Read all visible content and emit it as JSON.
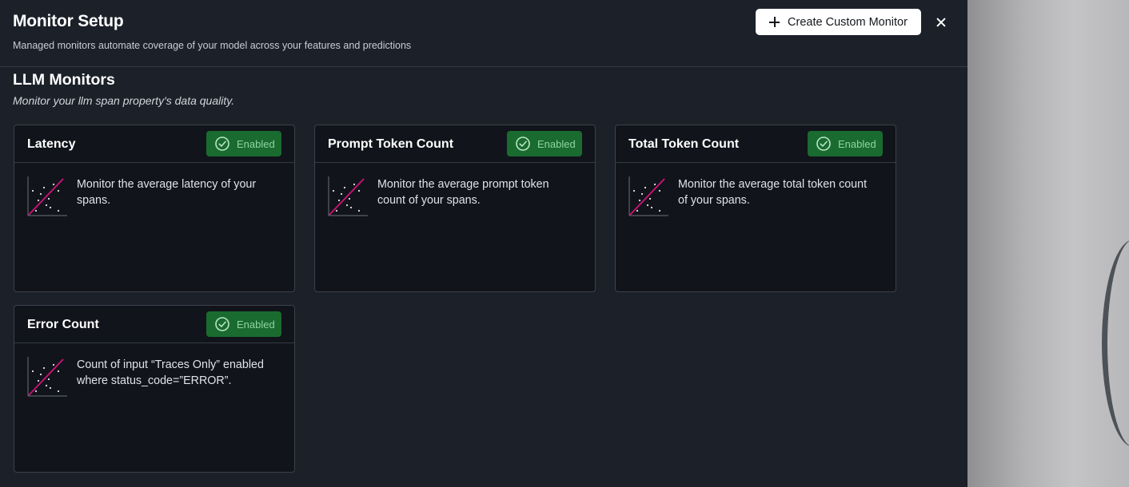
{
  "header": {
    "title": "Monitor Setup",
    "subtitle": "Managed monitors automate coverage of your model across your features and predictions",
    "create_button_label": "Create Custom Monitor"
  },
  "section": {
    "title": "LLM Monitors",
    "subtitle": "Monitor your llm span property's data quality."
  },
  "cards": [
    {
      "title": "Latency",
      "status": "Enabled",
      "description": "Monitor the average latency of your spans."
    },
    {
      "title": "Prompt Token Count",
      "status": "Enabled",
      "description": "Monitor the average prompt token count of your spans."
    },
    {
      "title": "Total Token Count",
      "status": "Enabled",
      "description": "Monitor the average total token count of your spans."
    },
    {
      "title": "Error Count",
      "status": "Enabled",
      "description": "Count of input “Traces Only” enabled where status_code=”ERROR”."
    }
  ],
  "colors": {
    "panel_bg": "#1b2029",
    "card_bg": "#11141a",
    "badge_bg": "#1a6b30",
    "badge_text": "#8fd4a2",
    "chart_line": "#d1127a"
  }
}
